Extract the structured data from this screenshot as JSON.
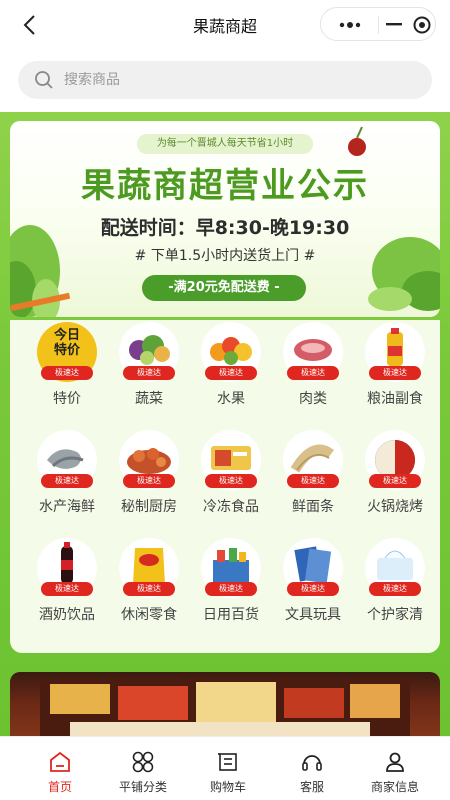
{
  "header": {
    "title": "果蔬商超"
  },
  "search": {
    "placeholder": "搜索商品"
  },
  "banner": {
    "slogan": "为每一个晋城人每天节省1小时",
    "title": "果蔬商超营业公示",
    "hours": "配送时间：早8:30-晚19:30",
    "notice": "# 下单1.5小时内送货上门 #",
    "pill": "-满20元免配送费 -"
  },
  "categories": [
    {
      "label": "特价",
      "tag": "极速达",
      "icon": "special-offer-icon",
      "badge": "今日\n特价"
    },
    {
      "label": "蔬菜",
      "tag": "极速达",
      "icon": "vegetables-icon"
    },
    {
      "label": "水果",
      "tag": "极速达",
      "icon": "fruits-icon"
    },
    {
      "label": "肉类",
      "tag": "极速达",
      "icon": "meat-icon"
    },
    {
      "label": "粮油副食",
      "tag": "极速达",
      "icon": "grain-oil-icon"
    },
    {
      "label": "水产海鲜",
      "tag": "极速达",
      "icon": "seafood-icon"
    },
    {
      "label": "秘制厨房",
      "tag": "极速达",
      "icon": "kitchen-icon"
    },
    {
      "label": "冷冻食品",
      "tag": "极速达",
      "icon": "frozen-food-icon"
    },
    {
      "label": "鲜面条",
      "tag": "极速达",
      "icon": "noodles-icon"
    },
    {
      "label": "火锅烧烤",
      "tag": "极速达",
      "icon": "hotpot-bbq-icon"
    },
    {
      "label": "酒奶饮品",
      "tag": "极速达",
      "icon": "drinks-icon"
    },
    {
      "label": "休闲零食",
      "tag": "极速达",
      "icon": "snacks-icon"
    },
    {
      "label": "日用百货",
      "tag": "极速达",
      "icon": "daily-goods-icon"
    },
    {
      "label": "文具玩具",
      "tag": "极速达",
      "icon": "stationery-toys-icon"
    },
    {
      "label": "个护家清",
      "tag": "极速达",
      "icon": "personal-care-icon"
    }
  ],
  "tabbar": {
    "items": [
      {
        "label": "首页",
        "icon": "home-icon",
        "active": true
      },
      {
        "label": "平铺分类",
        "icon": "category-grid-icon",
        "active": false
      },
      {
        "label": "购物车",
        "icon": "cart-icon",
        "active": false
      },
      {
        "label": "客服",
        "icon": "headset-icon",
        "active": false
      },
      {
        "label": "商家信息",
        "icon": "user-icon",
        "active": false
      }
    ]
  },
  "colors": {
    "accent": "#e0271f",
    "green": "#4c9a1f",
    "bg_green": "#79c93a"
  }
}
